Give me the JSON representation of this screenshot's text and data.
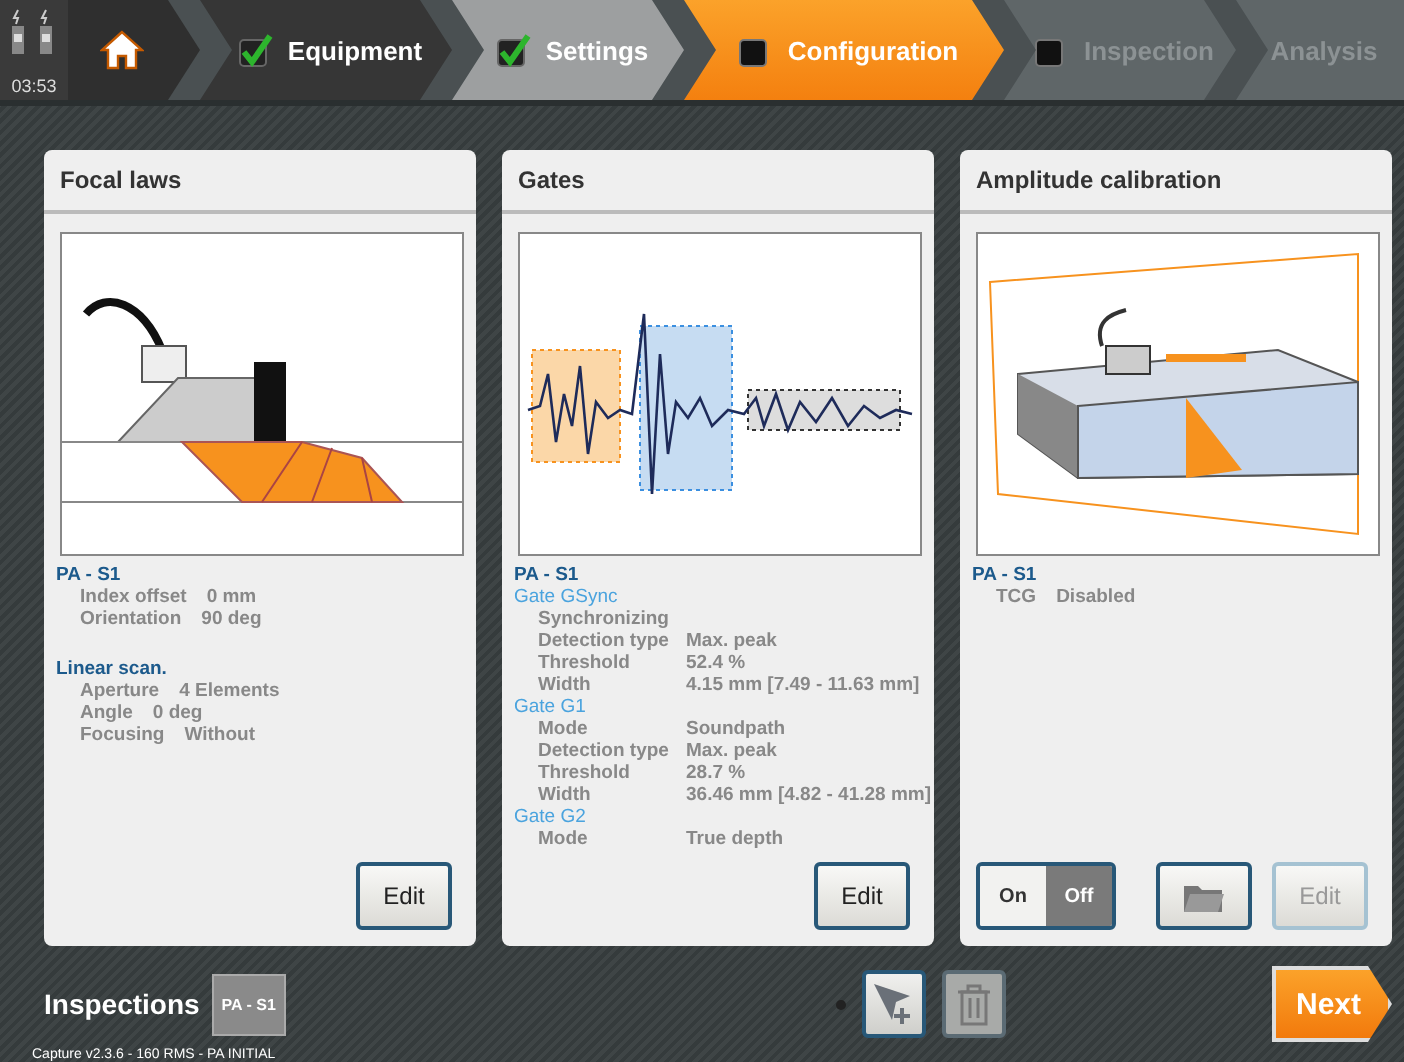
{
  "status": {
    "clock": "03:53"
  },
  "steps": [
    {
      "kind": "home"
    },
    {
      "kind": "step",
      "label": "Equipment",
      "checked": true,
      "selected": false
    },
    {
      "kind": "step",
      "label": "Settings",
      "checked": true,
      "selected": false
    },
    {
      "kind": "step",
      "label": "Configuration",
      "checked": false,
      "selected": true
    },
    {
      "kind": "step",
      "label": "Inspection",
      "checked": false,
      "selected": false
    },
    {
      "kind": "plain",
      "label": "Analysis",
      "selected": false
    }
  ],
  "panels": [
    {
      "title": "Focal laws",
      "kind": "focal",
      "sections": [
        {
          "heading": "PA - S1",
          "kind": "probe",
          "rows": [
            {
              "label": "Index offset",
              "value": "0 mm"
            },
            {
              "label": "Orientation",
              "value": "90 deg"
            }
          ]
        },
        {
          "heading": "Linear scan.",
          "kind": "scan",
          "rows": [
            {
              "label": "Aperture",
              "value": "4 Elements"
            },
            {
              "label": "Angle",
              "value": "0 deg"
            },
            {
              "label": "Focusing",
              "value": "Without"
            }
          ]
        }
      ],
      "buttons": [
        {
          "kind": "edit",
          "label": "Edit",
          "disabled": false
        }
      ]
    },
    {
      "title": "Gates",
      "kind": "gates",
      "sections": [
        {
          "heading": "PA - S1",
          "kind": "probe"
        },
        {
          "heading": "Gate GSync",
          "kind": "gate",
          "rows": [
            {
              "label": "Synchronizing"
            },
            {
              "label": "Detection type",
              "value": "Max. peak"
            },
            {
              "label": "Threshold",
              "value": "52.4 %"
            },
            {
              "label": "Width",
              "value": "4.15 mm [7.49 - 11.63 mm]"
            }
          ]
        },
        {
          "heading": "Gate G1",
          "kind": "gate",
          "rows": [
            {
              "label": "Mode",
              "value": "Soundpath"
            },
            {
              "label": "Detection type",
              "value": "Max. peak"
            },
            {
              "label": "Threshold",
              "value": "28.7 %"
            },
            {
              "label": "Width",
              "value": "36.46 mm [4.82 - 41.28 mm]"
            }
          ]
        },
        {
          "heading": "Gate G2",
          "kind": "gate",
          "rows": [
            {
              "label": "Mode",
              "value": "True depth"
            }
          ]
        }
      ],
      "buttons": [
        {
          "kind": "edit",
          "label": "Edit",
          "disabled": false
        }
      ]
    },
    {
      "title": "Amplitude calibration",
      "kind": "calibration",
      "sections": [
        {
          "heading": "PA - S1",
          "kind": "probe",
          "rows": [
            {
              "label": "TCG",
              "value": "Disabled"
            }
          ]
        }
      ],
      "toggle": [
        {
          "label": "On",
          "selected": false
        },
        {
          "label": "Off",
          "selected": true
        }
      ],
      "buttons": [
        {
          "kind": "folder",
          "disabled": false
        },
        {
          "kind": "edit",
          "label": "Edit",
          "disabled": true
        }
      ]
    }
  ],
  "footer": {
    "title": "Inspections",
    "tags": [
      "PA - S1"
    ],
    "tools": [
      {
        "kind": "add",
        "disabled": false
      },
      {
        "kind": "delete",
        "disabled": true
      }
    ],
    "next": "Next",
    "version": "Capture v2.3.6 - 160 RMS - PA INITIAL"
  }
}
